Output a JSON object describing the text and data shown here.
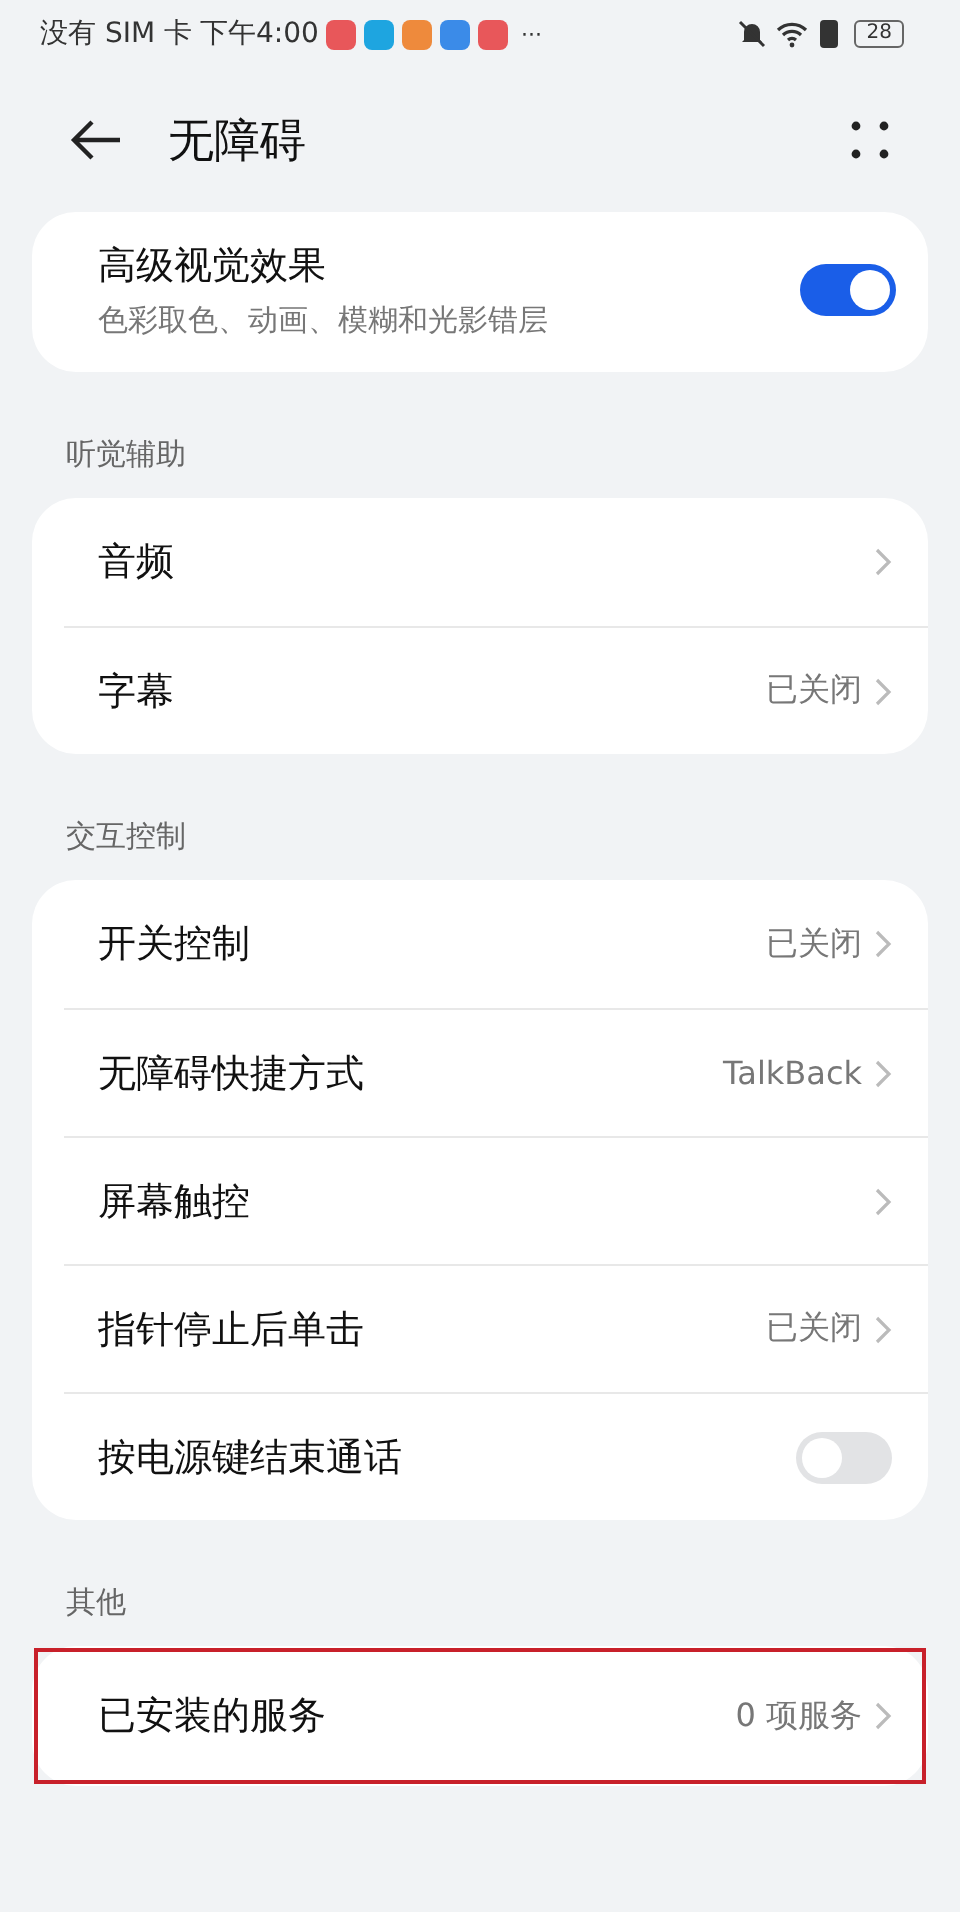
{
  "status_bar": {
    "carrier": "没有 SIM 卡",
    "time": "下午4:00",
    "more": "···",
    "battery": "28"
  },
  "header": {
    "title": "无障碍"
  },
  "top_card": {
    "title": "高级视觉效果",
    "subtitle": "色彩取色、动画、模糊和光影错层",
    "on": true
  },
  "sections": [
    {
      "label": "听觉辅助",
      "rows": [
        {
          "kind": "nav",
          "title": "音频",
          "highlighted": false
        },
        {
          "kind": "nav",
          "title": "字幕",
          "value": "已关闭",
          "highlighted": false
        }
      ]
    },
    {
      "label": "交互控制",
      "rows": [
        {
          "kind": "nav",
          "title": "开关控制",
          "value": "已关闭",
          "highlighted": false
        },
        {
          "kind": "nav",
          "title": "无障碍快捷方式",
          "value": "TalkBack",
          "highlighted": false
        },
        {
          "kind": "nav",
          "title": "屏幕触控",
          "highlighted": false
        },
        {
          "kind": "nav",
          "title": "指针停止后单击",
          "value": "已关闭",
          "highlighted": false
        },
        {
          "kind": "toggle",
          "title": "按电源键结束通话",
          "on": false,
          "highlighted": false
        }
      ]
    },
    {
      "label": "其他",
      "rows": [
        {
          "kind": "nav",
          "title": "已安装的服务",
          "value": "0 项服务",
          "highlighted": true
        }
      ]
    }
  ]
}
